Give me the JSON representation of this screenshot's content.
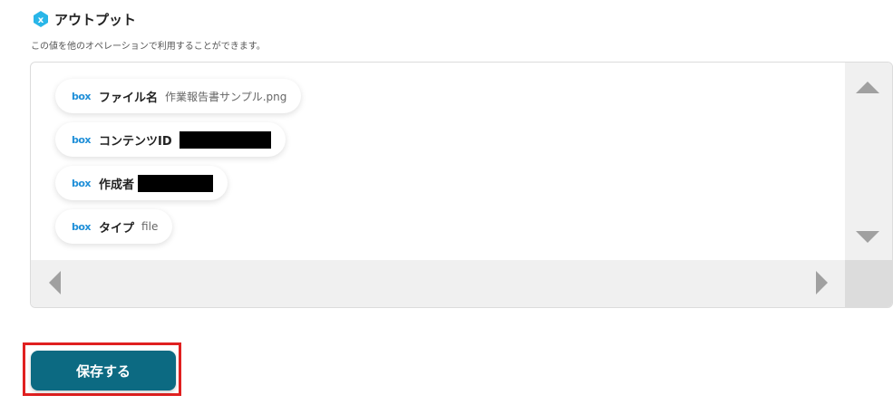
{
  "header": {
    "icon": "x-variable-icon",
    "icon_letter": "x",
    "icon_color": "#29b6e8",
    "title": "アウトプット",
    "subtitle": "この値を他のオペレーションで利用することができます。"
  },
  "outputs": [
    {
      "logo": "box",
      "label": "ファイル名",
      "value": "作業報告書サンプル.png",
      "redacted": false
    },
    {
      "logo": "box",
      "label": "コンテンツID",
      "value": "",
      "redacted": true
    },
    {
      "logo": "box",
      "label": "作成者",
      "value": "",
      "redacted": true
    },
    {
      "logo": "box",
      "label": "タイプ",
      "value": "file",
      "redacted": false
    }
  ],
  "save_button": {
    "label": "保存する",
    "color": "#0c6a82"
  },
  "highlight_color": "#e02020",
  "box_logo_color": "#1f8fd8"
}
